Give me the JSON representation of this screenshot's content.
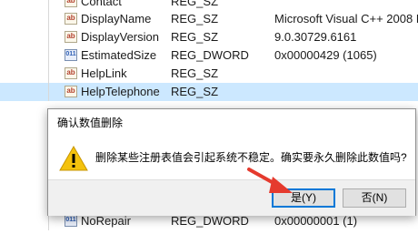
{
  "rows": [
    {
      "icon": "ab",
      "name": "Contact",
      "type": "REG_SZ",
      "data": ""
    },
    {
      "icon": "ab",
      "name": "DisplayName",
      "type": "REG_SZ",
      "data": "Microsoft Visual C++ 2008 R"
    },
    {
      "icon": "ab",
      "name": "DisplayVersion",
      "type": "REG_SZ",
      "data": "9.0.30729.6161"
    },
    {
      "icon": "bin",
      "name": "EstimatedSize",
      "type": "REG_DWORD",
      "data": "0x00000429 (1065)"
    },
    {
      "icon": "ab",
      "name": "HelpLink",
      "type": "REG_SZ",
      "data": ""
    },
    {
      "icon": "ab",
      "name": "HelpTelephone",
      "type": "REG_SZ",
      "data": ""
    },
    {
      "icon": "bin",
      "name": "NoRepair",
      "type": "REG_DWORD",
      "data": "0x00000001 (1)"
    }
  ],
  "dialog": {
    "title": "确认数值删除",
    "message": "删除某些注册表值会引起系统不稳定。确实要永久删除此数值吗?",
    "yes_label": "是(Y)",
    "no_label": "否(N)"
  },
  "colors": {
    "accent": "#0078d7",
    "arrow": "#e53a2e",
    "selection": "#cce8ff"
  }
}
